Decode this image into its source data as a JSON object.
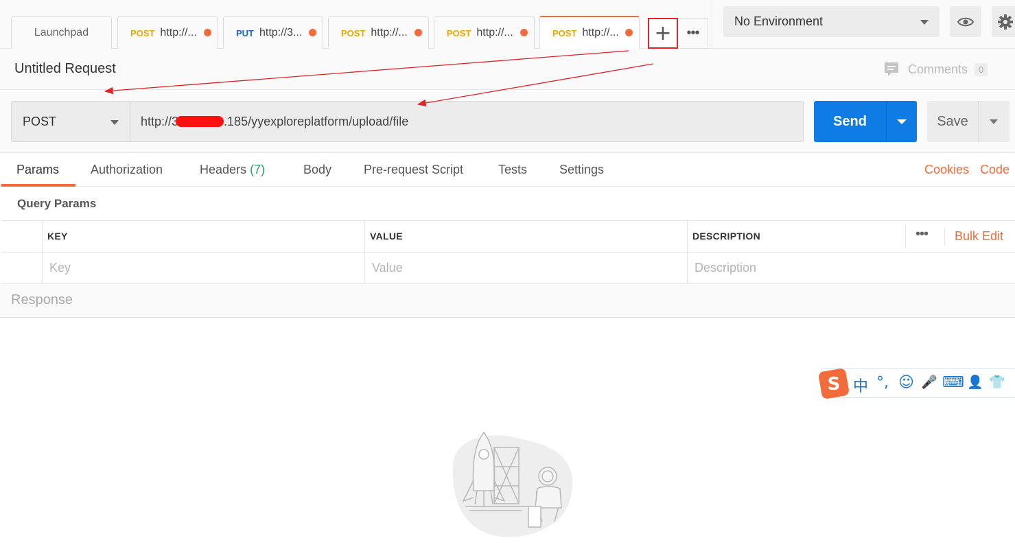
{
  "tabs": [
    {
      "label": "Launchpad"
    },
    {
      "method": "POST",
      "url": "http://...",
      "dirty": true
    },
    {
      "method": "PUT",
      "url": "http://3...",
      "dirty": true
    },
    {
      "method": "POST",
      "url": "http://...",
      "dirty": true
    },
    {
      "method": "POST",
      "url": "http://...",
      "dirty": true
    },
    {
      "method": "POST",
      "url": "http://...",
      "dirty": true,
      "active": true
    }
  ],
  "environment": {
    "selected": "No Environment"
  },
  "request": {
    "title": "Untitled Request",
    "comments_label": "Comments",
    "comments_count": "0",
    "method": "POST",
    "url_prefix": "http://3",
    "url_suffix": ".185/yyexploreplatform/upload/file",
    "send_label": "Send",
    "save_label": "Save"
  },
  "request_tabs": [
    {
      "label": "Params",
      "active": true
    },
    {
      "label": "Authorization"
    },
    {
      "label": "Headers",
      "count": "(7)"
    },
    {
      "label": "Body"
    },
    {
      "label": "Pre-request Script"
    },
    {
      "label": "Tests"
    },
    {
      "label": "Settings"
    }
  ],
  "links": {
    "cookies": "Cookies",
    "code": "Code"
  },
  "query_params": {
    "title": "Query Params",
    "columns": [
      "KEY",
      "VALUE",
      "DESCRIPTION"
    ],
    "placeholders": {
      "key": "Key",
      "value": "Value",
      "description": "Description"
    },
    "bulk_edit": "Bulk Edit",
    "more": "•••"
  },
  "response": {
    "title": "Response"
  },
  "ime": {
    "items": [
      "中",
      "°,",
      "☺",
      "🎤",
      "⌨",
      "👤",
      "👕"
    ]
  },
  "colors": {
    "accent": "#f26b3a",
    "send": "#0f7ce6",
    "post": "#e5a800",
    "put": "#1766d1",
    "annotation": "#e0242b"
  },
  "misc": {
    "more_tabs": "•••",
    "new_tab_icon": "+"
  }
}
